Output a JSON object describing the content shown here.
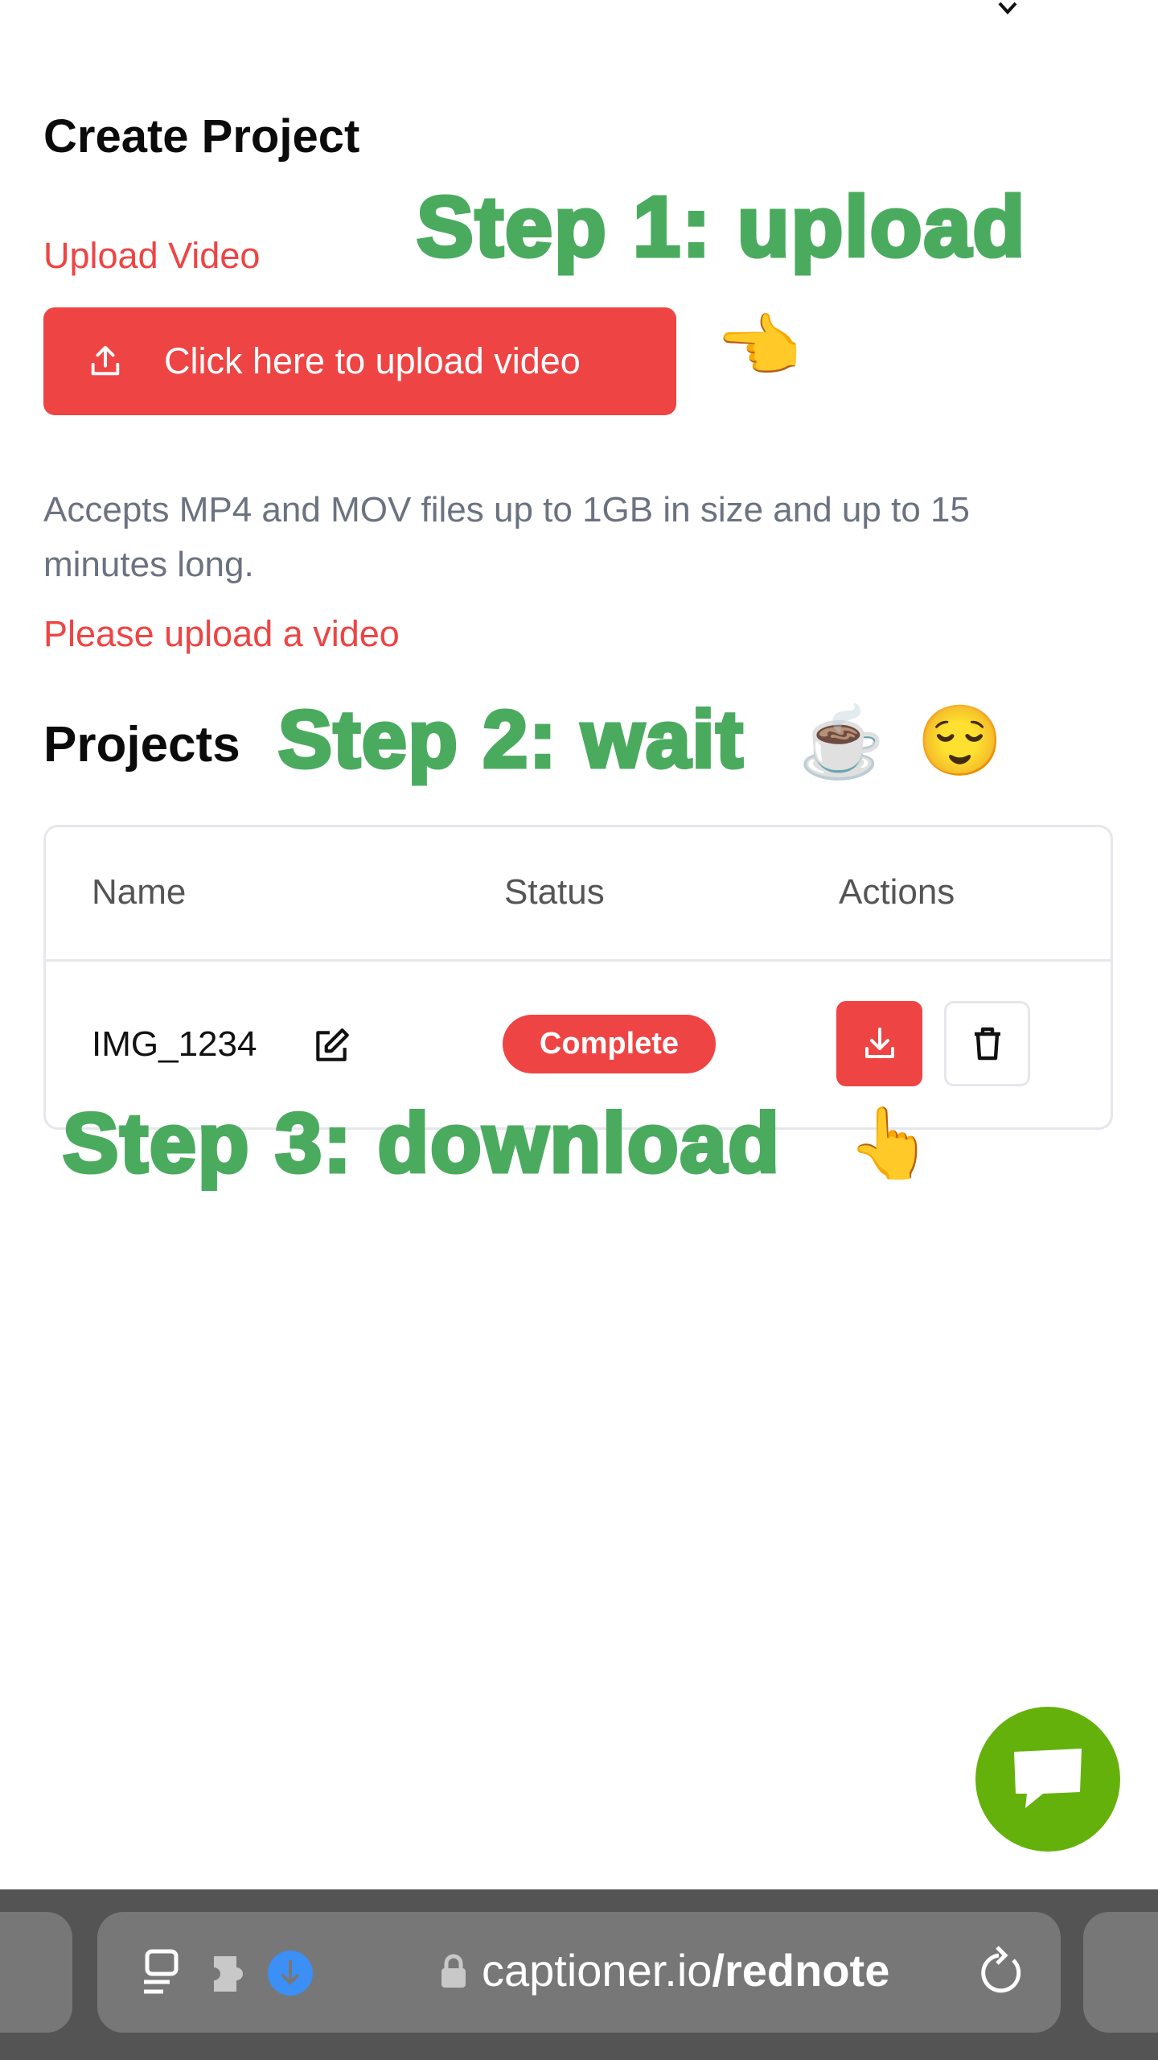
{
  "header": {
    "collapse_icon": "chevron-down-icon"
  },
  "create": {
    "title": "Create Project",
    "upload_label": "Upload Video",
    "upload_button": "Click here to upload video",
    "hint": "Accepts MP4 and MOV files up to 1GB in size and up to 15 minutes long.",
    "error": "Please upload a video"
  },
  "annotations": {
    "step1": "Step 1: upload",
    "step1_emoji": "👈",
    "step2": "Step 2: wait",
    "step2_emoji1": "☕",
    "step2_emoji2": "😌",
    "step3": "Step 3: download",
    "step3_emoji": "👆"
  },
  "projects": {
    "title": "Projects",
    "columns": [
      "Name",
      "Status",
      "Actions"
    ],
    "rows": [
      {
        "name": "IMG_1234",
        "status": "Complete"
      }
    ]
  },
  "browser": {
    "url_domain": "captioner.io",
    "url_path": "/rednote"
  },
  "colors": {
    "accent": "#ef4444",
    "annotation": "#4aab5f",
    "chat": "#65b10c",
    "download_badge": "#3b8ff5"
  }
}
